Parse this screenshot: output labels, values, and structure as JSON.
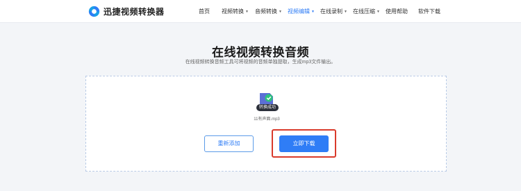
{
  "brand": {
    "name": "迅捷视频转换器",
    "logo_icon": "swirl-logo-icon",
    "accent_color": "#2f7df6"
  },
  "nav": {
    "items": [
      {
        "label": "首页",
        "has_dropdown": false,
        "active": false
      },
      {
        "label": "视频转换",
        "has_dropdown": true,
        "active": false
      },
      {
        "label": "音频转换",
        "has_dropdown": true,
        "active": false
      },
      {
        "label": "视频编辑",
        "has_dropdown": true,
        "active": true
      },
      {
        "label": "在线录制",
        "has_dropdown": true,
        "active": false
      },
      {
        "label": "在线压缩",
        "has_dropdown": true,
        "active": false
      },
      {
        "label": "使用帮助",
        "has_dropdown": false,
        "active": false
      },
      {
        "label": "软件下载",
        "has_dropdown": false,
        "active": false
      }
    ],
    "dropdown_icon": "caret-down-icon"
  },
  "main": {
    "title": "在线视频转换音频",
    "subtitle": "在线视频转换音频工具可将视频的音频单独提取，生成mp3文件输出。",
    "file": {
      "icon": "audio-file-icon",
      "status_icon": "check-circle-icon",
      "status": "转换成功",
      "name": "11有声面.mp3"
    },
    "actions": {
      "readd_label": "重新添加",
      "download_label": "立即下载",
      "highlight_color": "#d93a2b"
    }
  }
}
